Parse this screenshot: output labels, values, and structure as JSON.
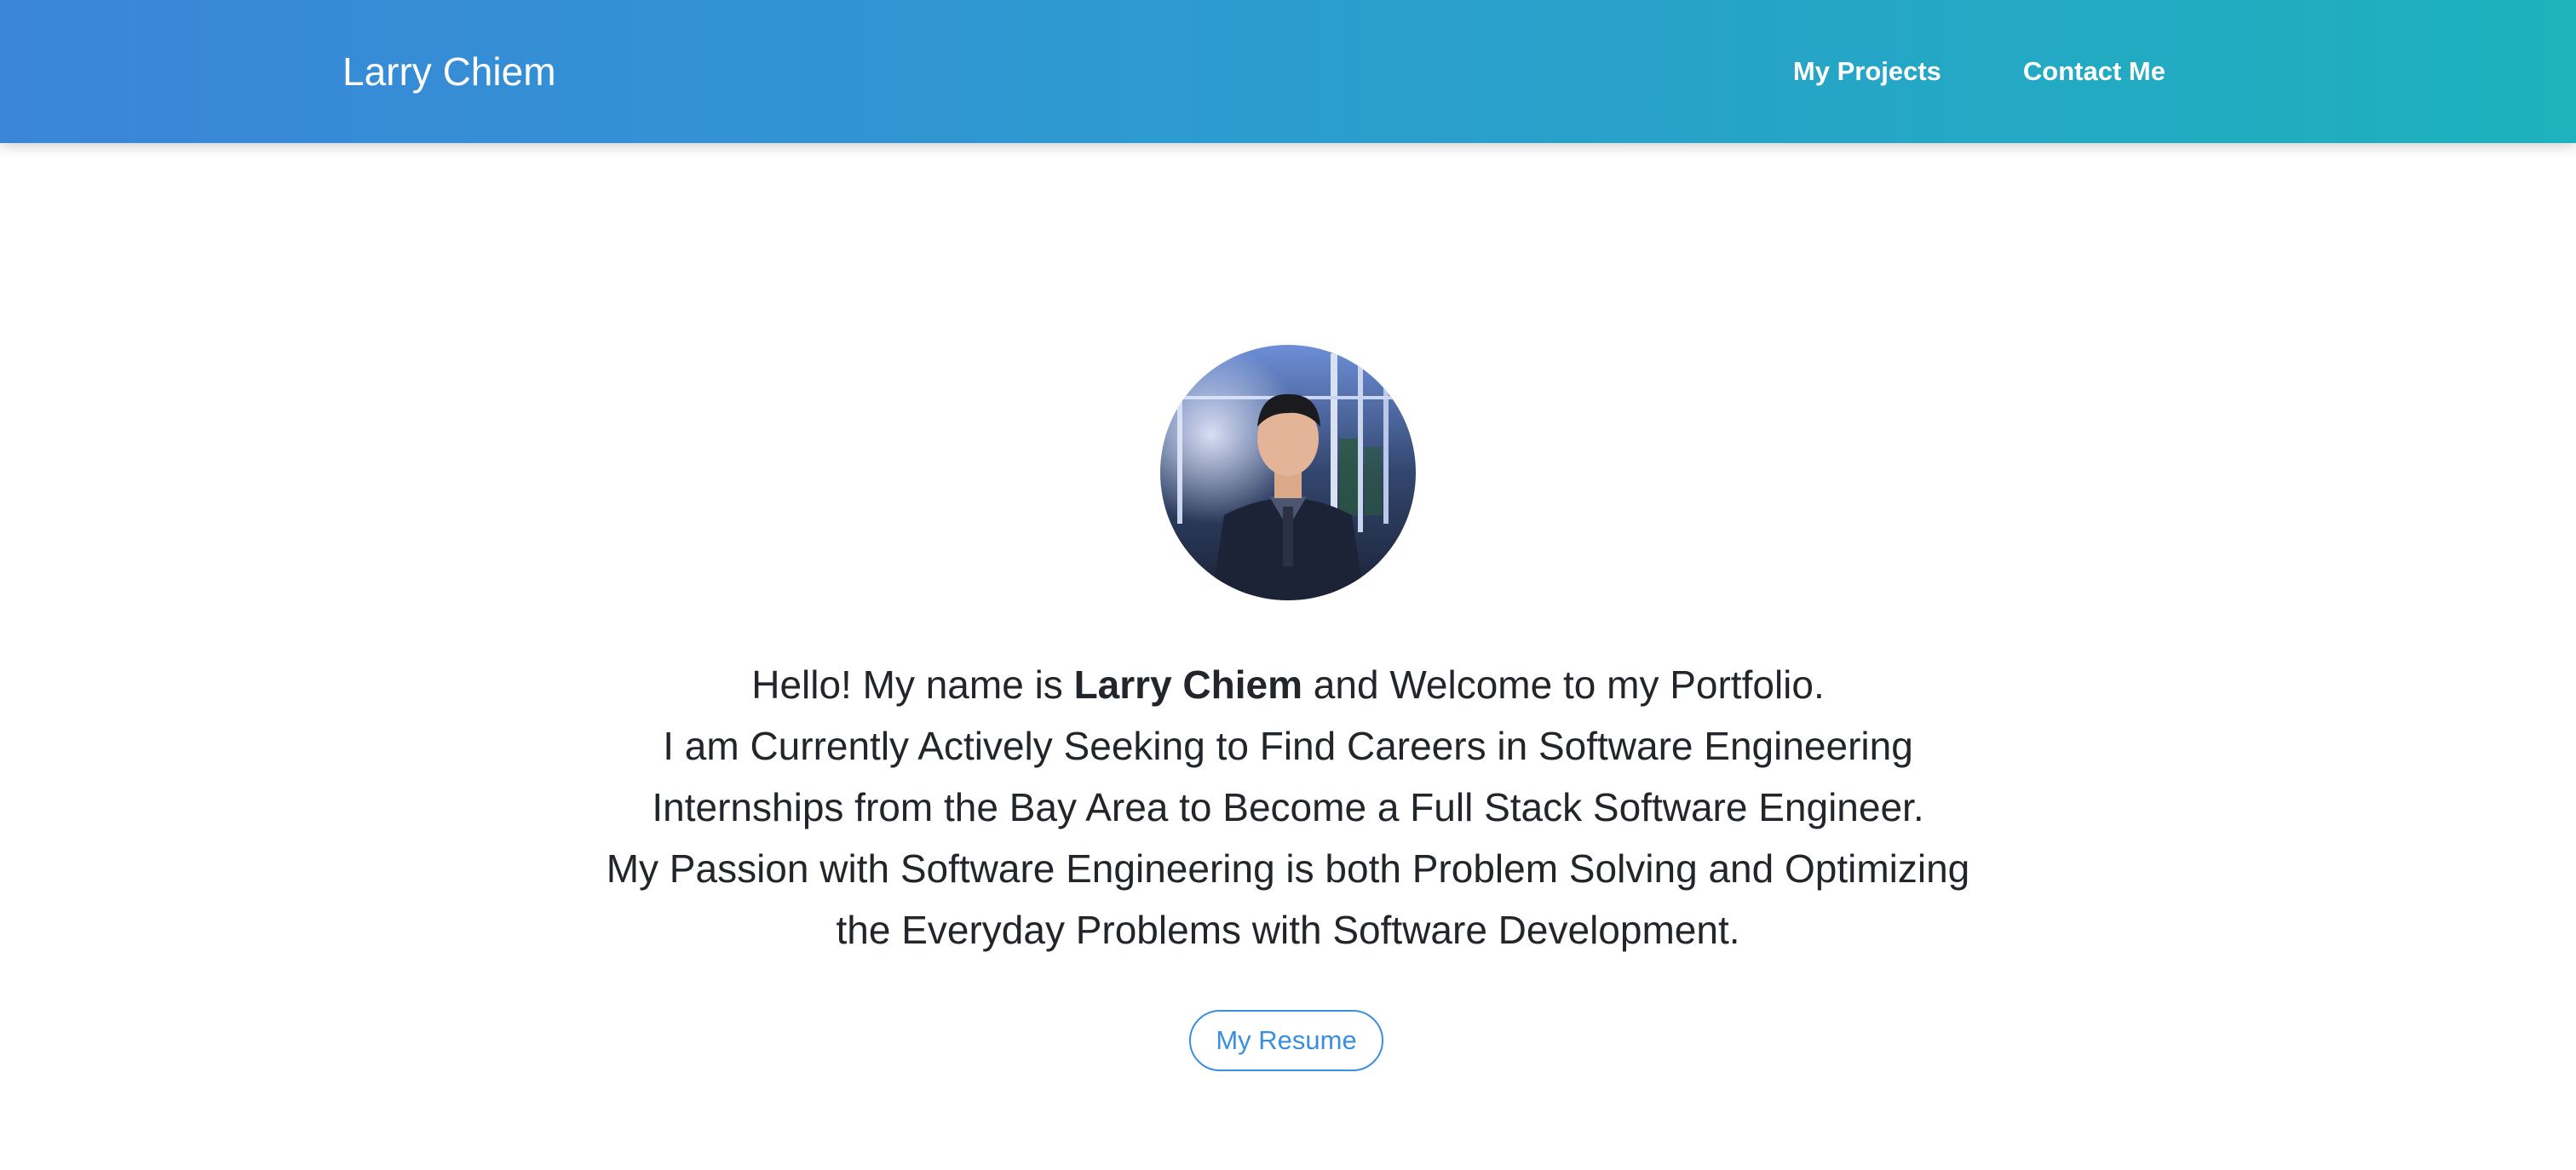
{
  "navbar": {
    "brand": "Larry Chiem",
    "links": [
      {
        "label": "My Projects"
      },
      {
        "label": "Contact Me"
      }
    ],
    "gradient_start": "#3b85d8",
    "gradient_end": "#1db2bc"
  },
  "hero": {
    "intro_prefix": "Hello! My name is ",
    "intro_name": "Larry Chiem",
    "intro_suffix": " and Welcome to my Portfolio.",
    "lines": [
      "I am Currently Actively Seeking to Find Careers in Software Engineering",
      "Internships from the Bay Area to Become a Full Stack Software Engineer.",
      "My Passion with Software Engineering is both Problem Solving and Optimizing",
      "the Everyday Problems with Software Development."
    ],
    "resume_button": "My Resume",
    "accent_color": "#3a8ee0"
  }
}
